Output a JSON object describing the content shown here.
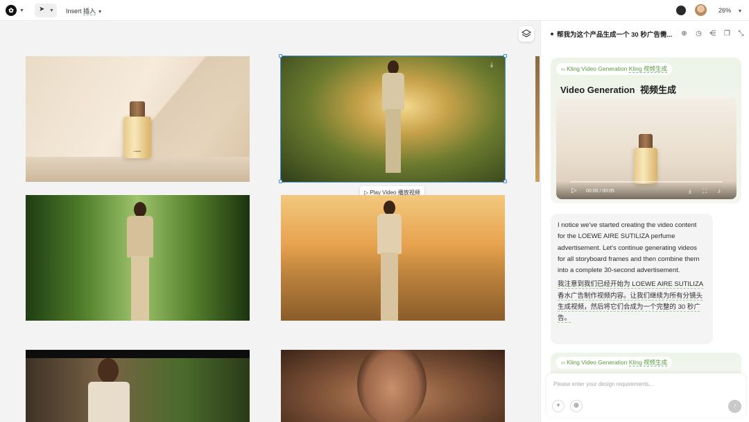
{
  "topbar": {
    "logo_icon": "video-logo-icon",
    "insert_label": "Insert",
    "insert_label_cn": "插入",
    "zoom": "26%"
  },
  "canvas": {
    "frames": [
      {
        "name": "perfume-bottle-shot"
      },
      {
        "name": "woman-walking-garden-path"
      },
      {
        "name": "woman-in-garden-greenery"
      },
      {
        "name": "woman-in-field-sunset"
      },
      {
        "name": "woman-with-plants"
      },
      {
        "name": "woman-closeup-shadow"
      }
    ],
    "bottle_label": "LOEWE",
    "play_video_label": "Play Video",
    "play_video_label_cn": "播放视频"
  },
  "panel": {
    "conversation_title": "帮我为这个产品生成一个 30 秒广告需...",
    "card": {
      "tag": "Kling Video Generation",
      "tag_cn": "Kling 视频生成",
      "title": "Video Generation",
      "title_cn": "视频生成",
      "video_time": "00:00 / 00:05"
    },
    "message": {
      "en": "I notice we've started creating the video content for the LOEWE AIRE SUTILIZA perfume advertisement. Let's continue generating videos for all storyboard frames and then combine them into a complete 30-second advertisement.",
      "cn": "我注意到我们已经开始为 LOEWE AIRE SUTILIZA 香水广告制作视频内容。让我们继续为所有分镜头生成视频，然后将它们合成为一个完整的 30 秒广告。"
    },
    "card2": {
      "tag": "Kling Video Generation",
      "tag_cn": "Kling 视频生成"
    },
    "composer": {
      "placeholder": "Please enter your design requirements..."
    }
  },
  "colors": {
    "accent": "#4a90e2",
    "tag_green": "#5a9b3e",
    "card_bg": "#eef4e8"
  }
}
